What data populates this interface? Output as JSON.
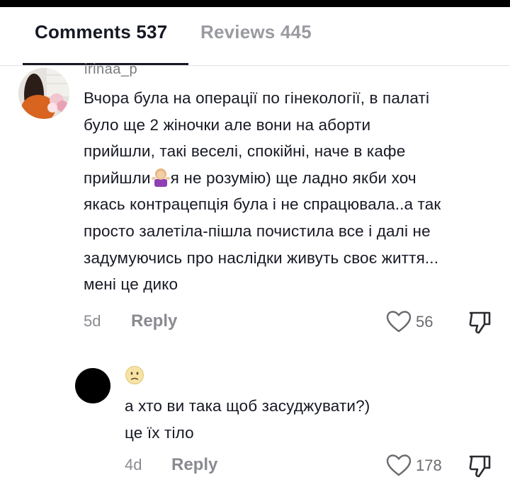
{
  "tabs": [
    {
      "label": "Comments 537",
      "active": true
    },
    {
      "label": "Reviews 445",
      "active": false
    }
  ],
  "comments": [
    {
      "username": "irinaa_p",
      "lines": [
        "Вчора була на операції по гінекології, в палаті",
        "було ще 2 жіночки але вони на аборти",
        "прийшли, такі веселі, спокійні, наче в кафе",
        "прийшли",
        "я не розумію) ще ладно якби хоч",
        "якась контрацепція була і не спрацювала..а так",
        "просто залетіла-пішла почистила все і далі не",
        "задумуючись про наслідки живуть своє життя...",
        "мені це дико"
      ],
      "time": "5d",
      "reply_label": "Reply",
      "likes": "56"
    },
    {
      "lines": [
        "а хто ви така щоб засуджувати?)",
        "це їх тіло"
      ],
      "time": "4d",
      "reply_label": "Reply",
      "likes": "178"
    }
  ],
  "colors": {
    "text": "#161823",
    "muted": "#8a8b91",
    "divider": "#e3e3e4"
  }
}
